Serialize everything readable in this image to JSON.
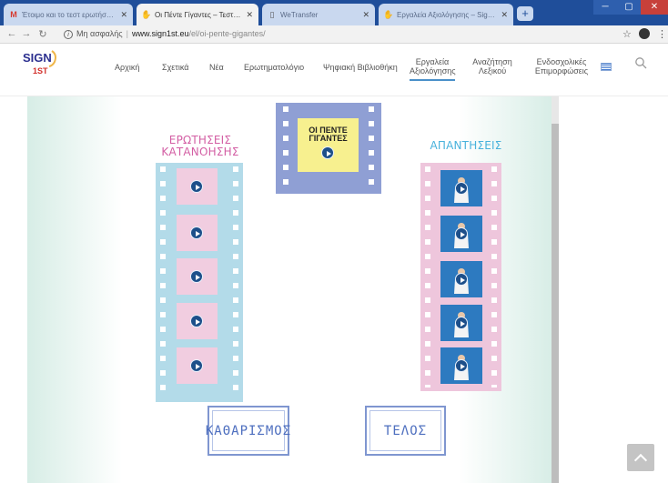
{
  "browser": {
    "tabs": [
      {
        "title": "Έτοιμο και το τεστ ερωτήσεων",
        "favicon": "gmail-icon",
        "active": false
      },
      {
        "title": "Οι Πέντε Γίγαντες – Τεστ κατανό",
        "favicon": "sign1st-icon",
        "active": true
      },
      {
        "title": "WeTransfer",
        "favicon": "page-icon",
        "active": false
      },
      {
        "title": "Εργαλεία Αξιολόγησης – Sign Fi",
        "favicon": "sign1st-icon",
        "active": false
      }
    ],
    "new_tab": "+",
    "address": {
      "security_label": "Μη ασφαλής",
      "host": "www.sign1st.eu",
      "path": "/el/oi-pente-gigantes/"
    }
  },
  "site": {
    "logo_text": "SIGN",
    "logo_sub": "1ST",
    "nav": [
      {
        "label": "Αρχική"
      },
      {
        "label": "Σχετικά"
      },
      {
        "label": "Νέα"
      },
      {
        "label": "Ερωτηματολόγιο"
      },
      {
        "label": "Ψηφιακή Βιβλιοθήκη"
      },
      {
        "label": "Εργαλεία Αξιολόγησης",
        "active": true
      },
      {
        "label": "Αναζήτηση Λεξικού"
      },
      {
        "label": "Ενδοσχολικές Επιμορφώσεις"
      }
    ]
  },
  "activity": {
    "title_line1": "ΟΙ ΠΕΝΤΕ",
    "title_line2": "ΓΙΓΑΝΤΕΣ",
    "questions_heading_line1": "ΕΡΩΤΗΣΕΙΣ",
    "questions_heading_line2": "ΚΑΤΑΝΟΗΣΗΣ",
    "answers_heading": "ΑΠΑΝΤΗΣΕΙΣ",
    "question_count": 5,
    "answer_count": 5,
    "clear_button": "ΚΑΘΑΡΙΣΜΟΣ",
    "end_button": "ΤΕΛΟΣ"
  },
  "colors": {
    "tab_strip": "#1f4e9a",
    "question_film": "#b3dbe9",
    "question_frame": "#f1cde0",
    "answer_film": "#eec6dc",
    "answer_frame": "#2d7ac0",
    "title_film": "#8f9fd4",
    "title_frame": "#f7f08f",
    "questions_heading": "#d35fa4",
    "answers_heading": "#48b2dc",
    "button_text": "#4e6fbf"
  }
}
